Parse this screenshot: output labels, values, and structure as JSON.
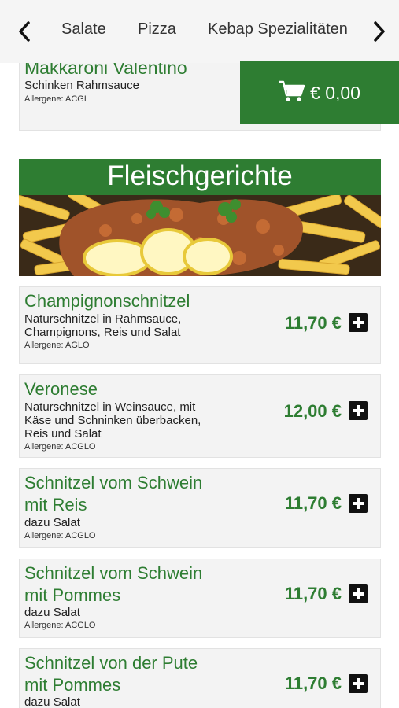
{
  "nav": {
    "items": [
      "Salate",
      "Pizza",
      "Kebap Spezialitäten"
    ]
  },
  "cart": {
    "amount": "€ 0,00"
  },
  "previous_item": {
    "name": "Makkaroni Valentino",
    "description": "Schinken Rahmsauce",
    "allergens": "Allergene: ACGL"
  },
  "category": {
    "title": "Fleischgerichte"
  },
  "items": [
    {
      "name": "Champignonschnitzel",
      "description": [
        "Naturschnitzel in Rahmsauce,",
        "Champignons, Reis und Salat"
      ],
      "allergens": "Allergene: AGLO",
      "price": "11,70 €"
    },
    {
      "name": "Veronese",
      "description": [
        "Naturschnitzel in Weinsauce, mit",
        "Käse und Schninken überbacken,",
        "Reis und Salat"
      ],
      "allergens": "Allergene: ACGLO",
      "price": "12,00 €"
    },
    {
      "name": [
        "Schnitzel vom Schwein",
        "mit Reis"
      ],
      "description": "dazu Salat",
      "allergens": "Allergene: ACGLO",
      "price": "11,70 €"
    },
    {
      "name": [
        "Schnitzel vom Schwein",
        "mit Pommes"
      ],
      "description": "dazu Salat",
      "allergens": "Allergene: ACGLO",
      "price": "11,70 €"
    },
    {
      "name": [
        "Schnitzel von der Pute",
        "mit Pommes"
      ],
      "description": "dazu Salat",
      "price": "11,70 €"
    }
  ],
  "colors": {
    "brand_green": "#2e7d32",
    "card_bg": "#f3f3f3"
  },
  "icons": [
    "chevron-left-icon",
    "chevron-right-icon",
    "cart-icon",
    "plus-icon"
  ]
}
